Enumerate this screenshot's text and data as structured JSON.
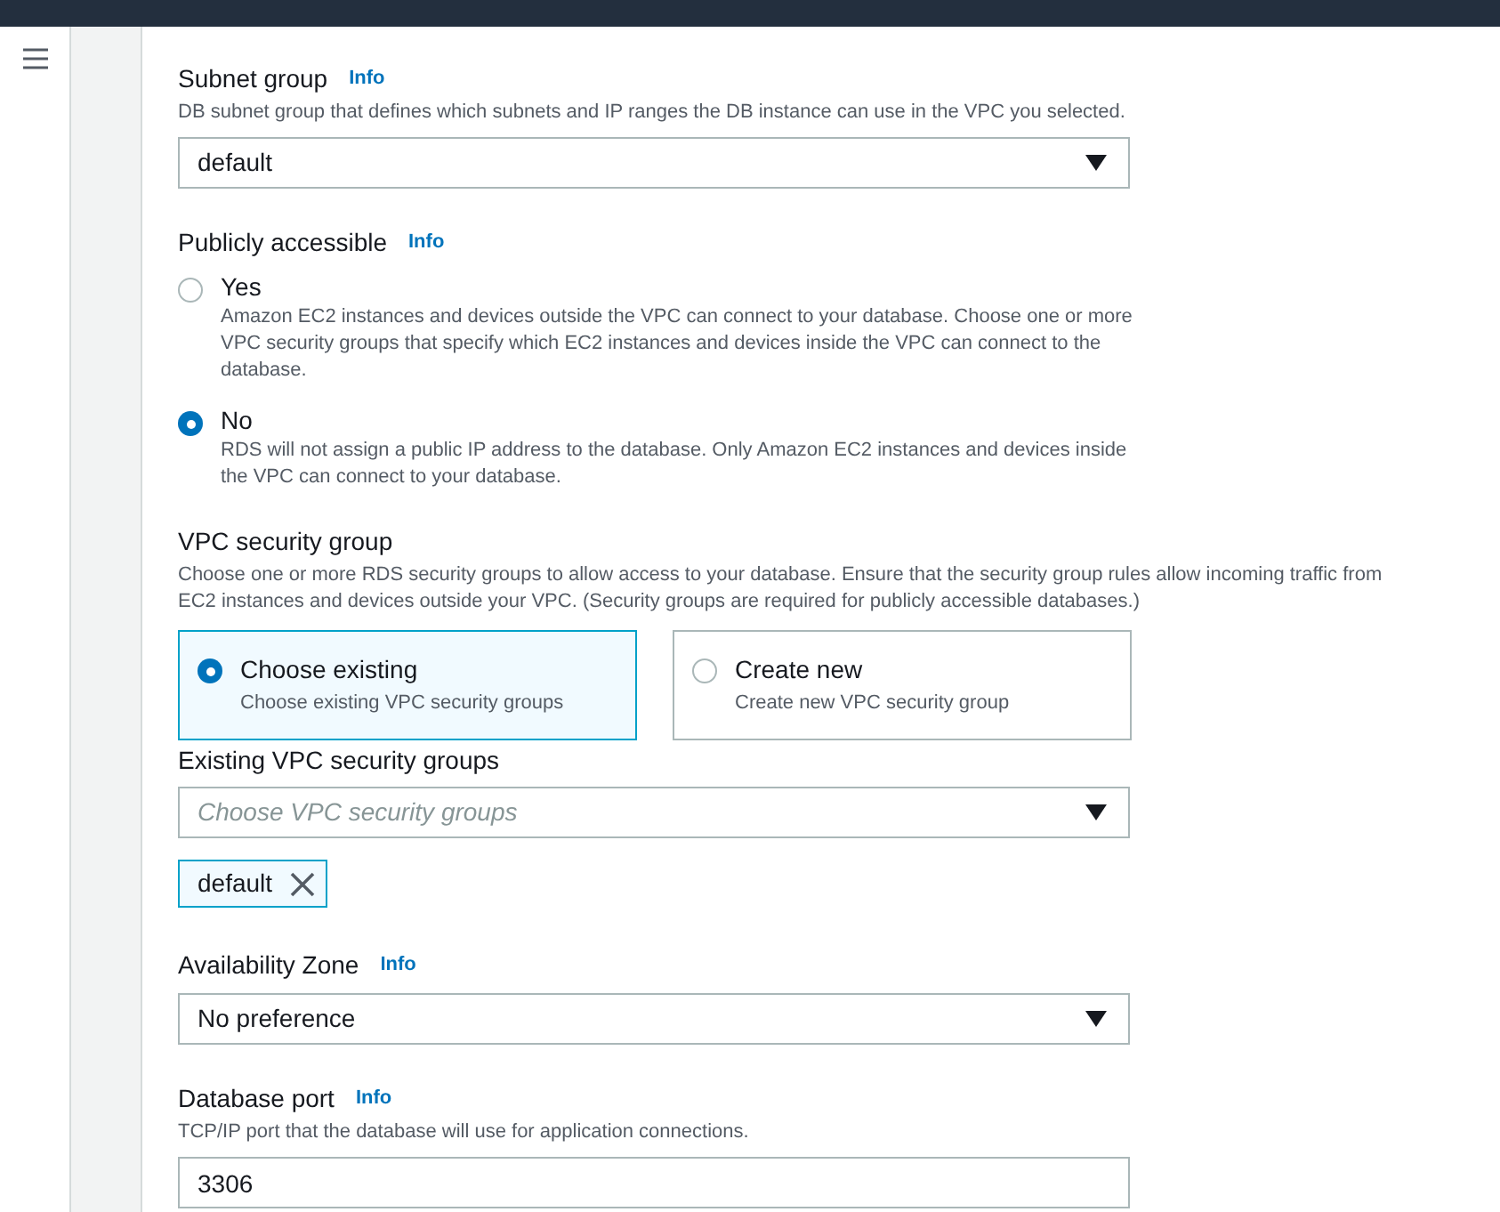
{
  "subnet_group": {
    "label": "Subnet group",
    "info": "Info",
    "description": "DB subnet group that defines which subnets and IP ranges the DB instance can use in the VPC you selected.",
    "value": "default"
  },
  "publicly_accessible": {
    "label": "Publicly accessible",
    "info": "Info",
    "options": [
      {
        "label": "Yes",
        "description": "Amazon EC2 instances and devices outside the VPC can connect to your database. Choose one or more VPC security groups that specify which EC2 instances and devices inside the VPC can connect to the database.",
        "selected": false
      },
      {
        "label": "No",
        "description": "RDS will not assign a public IP address to the database. Only Amazon EC2 instances and devices inside the VPC can connect to your database.",
        "selected": true
      }
    ]
  },
  "vpc_security_group": {
    "label": "VPC security group",
    "description": "Choose one or more RDS security groups to allow access to your database. Ensure that the security group rules allow incoming traffic from EC2 instances and devices outside your VPC. (Security groups are required for publicly accessible databases.)",
    "options": [
      {
        "label": "Choose existing",
        "description": "Choose existing VPC security groups",
        "selected": true
      },
      {
        "label": "Create new",
        "description": "Create new VPC security group",
        "selected": false
      }
    ]
  },
  "existing_security_groups": {
    "label": "Existing VPC security groups",
    "placeholder": "Choose VPC security groups",
    "tokens": [
      "default"
    ]
  },
  "availability_zone": {
    "label": "Availability Zone",
    "info": "Info",
    "value": "No preference"
  },
  "database_port": {
    "label": "Database port",
    "info": "Info",
    "description": "TCP/IP port that the database will use for application connections.",
    "value": "3306"
  }
}
